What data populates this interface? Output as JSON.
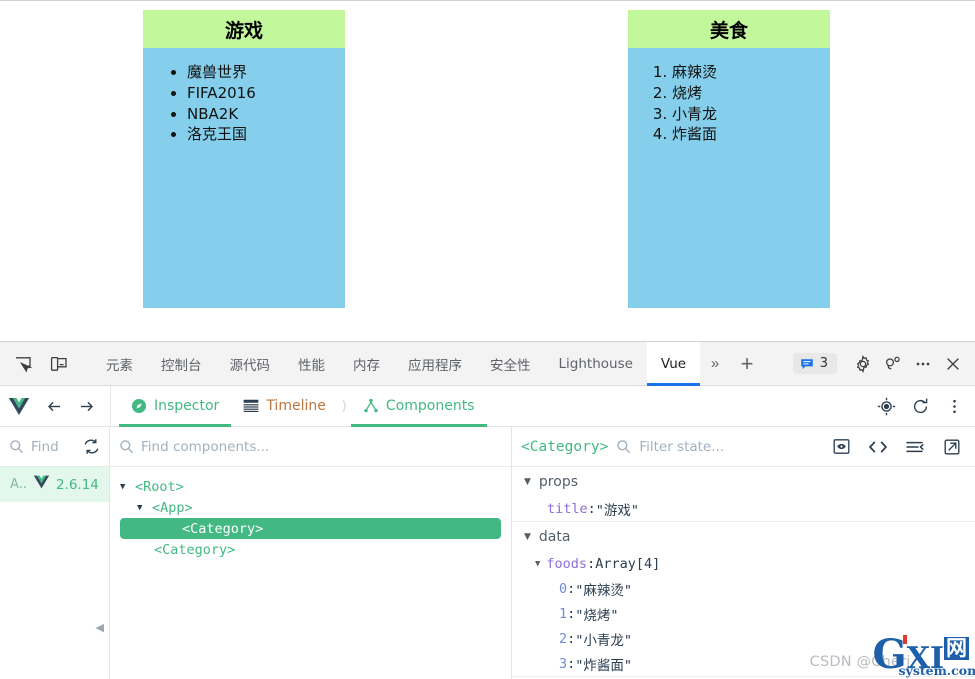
{
  "page": {
    "cards": [
      {
        "title": "游戏",
        "list_type": "bullet",
        "items": [
          "魔兽世界",
          "FIFA2016",
          "NBA2K",
          "洛克王国"
        ]
      },
      {
        "title": "美食",
        "list_type": "number",
        "items": [
          "麻辣烫",
          "烧烤",
          "小青龙",
          "炸酱面"
        ]
      }
    ],
    "card_colors": {
      "header_bg": "#C2F79C",
      "body_bg": "#85CFEC"
    }
  },
  "devtools": {
    "tabs": [
      {
        "label": "元素",
        "active": false
      },
      {
        "label": "控制台",
        "active": false
      },
      {
        "label": "源代码",
        "active": false
      },
      {
        "label": "性能",
        "active": false
      },
      {
        "label": "内存",
        "active": false
      },
      {
        "label": "应用程序",
        "active": false
      },
      {
        "label": "安全性",
        "active": false
      },
      {
        "label": "Lighthouse",
        "active": false
      },
      {
        "label": "Vue",
        "active": true
      }
    ],
    "more_tabs_icon": "chevron-double-right-icon",
    "add_tab_icon": "plus-icon",
    "inspect_icon": "inspect-element-icon",
    "device_icon": "device-toolbar-icon",
    "issues_badge": {
      "icon": "message-icon",
      "count": "3",
      "color": "#1a73e8"
    },
    "settings_icon": "gear-icon",
    "customize_icon": "customize-icon",
    "more_icon": "ellipsis-icon",
    "close_icon": "close-icon"
  },
  "vue_toolbar": {
    "logo": "vue-logo",
    "back_icon": "arrow-left-icon",
    "forward_icon": "arrow-right-icon",
    "items": [
      {
        "label": "Inspector",
        "icon": "compass-icon",
        "active": true
      },
      {
        "label": "Timeline",
        "icon": "timeline-icon",
        "active": false
      }
    ],
    "separator_icon": "chevron-right-icon",
    "sub_item": {
      "label": "Components",
      "icon": "components-tree-icon",
      "active": true
    },
    "right_icons": [
      "target-icon",
      "refresh-icon",
      "vertical-dots-icon"
    ]
  },
  "versions_pane": {
    "search_placeholder": "Find",
    "search_icon": "search-icon",
    "refresh_icon": "refresh-apps-icon",
    "app_label": "A..",
    "vue_badge_icon": "vue-logo-small",
    "version": "2.6.14",
    "collapse_icon": "collapse-left-icon"
  },
  "tree_pane": {
    "search_placeholder": "Find components...",
    "search_icon": "search-icon",
    "nodes": [
      {
        "label": "<Root>",
        "depth": 0,
        "expandable": true,
        "selected": false
      },
      {
        "label": "<App>",
        "depth": 1,
        "expandable": true,
        "selected": false
      },
      {
        "label": "<Category>",
        "depth": 2,
        "expandable": false,
        "selected": true
      },
      {
        "label": "<Category>",
        "depth": 2,
        "expandable": false,
        "selected": false
      }
    ]
  },
  "state_pane": {
    "component_name": "<Category>",
    "filter_placeholder": "Filter state...",
    "search_icon": "search-icon",
    "icons": [
      "eye-icon",
      "code-brackets-icon",
      "collapse-all-icon",
      "open-external-icon"
    ],
    "groups": [
      {
        "name": "props",
        "rows": [
          {
            "key": "title",
            "sep": ": ",
            "value": "\"游戏\"",
            "key_color": "#8e6fd8"
          }
        ]
      },
      {
        "name": "data",
        "array_row": {
          "key": "foods",
          "sep": ": ",
          "value": "Array[4]"
        },
        "rows": [
          {
            "key": "0",
            "sep": ": ",
            "value": "\"麻辣烫\""
          },
          {
            "key": "1",
            "sep": ": ",
            "value": "\"烧烤\""
          },
          {
            "key": "2",
            "sep": ": ",
            "value": "\"小青龙\""
          },
          {
            "key": "3",
            "sep": ": ",
            "value": "\"炸酱面\""
          }
        ]
      }
    ]
  },
  "watermark": {
    "csdn": "CSDN @Cheri",
    "logo_g": "G",
    "logo_xi": "XI",
    "logo_wang": "网",
    "logo_sub": "system.com"
  }
}
